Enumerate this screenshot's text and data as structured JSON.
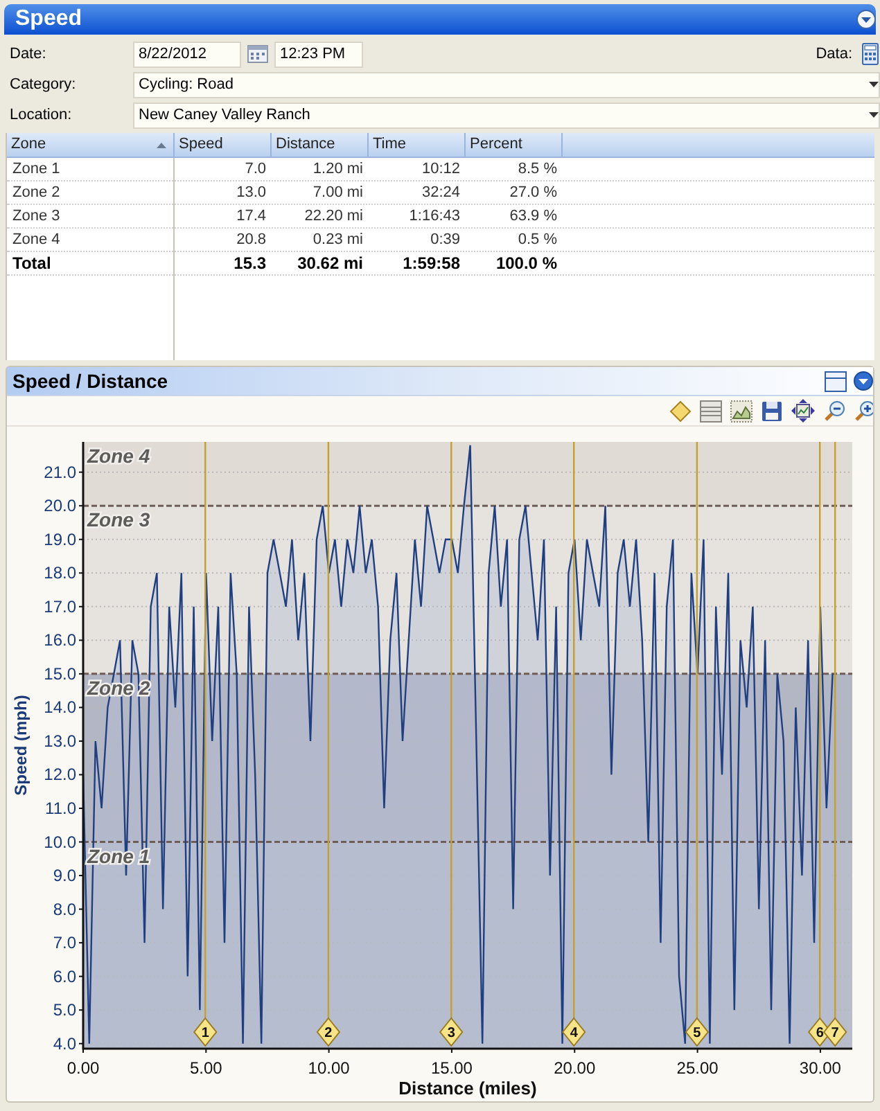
{
  "window": {
    "title": "Speed"
  },
  "form": {
    "date_label": "Date:",
    "date": "8/22/2012",
    "time": "12:23 PM",
    "data_label": "Data:",
    "category_label": "Category:",
    "category": "Cycling: Road",
    "location_label": "Location:",
    "location": "New Caney  Valley Ranch"
  },
  "table": {
    "columns": [
      {
        "label": "Zone",
        "sorted": true
      },
      {
        "label": "Speed",
        "sorted": false
      },
      {
        "label": "Distance",
        "sorted": false
      },
      {
        "label": "Time",
        "sorted": false
      },
      {
        "label": "Percent",
        "sorted": false
      }
    ],
    "rows": [
      {
        "kind": "zone",
        "cells": [
          "Zone 1",
          "7.0",
          "1.20 mi",
          "10:12",
          "8.5 %"
        ]
      },
      {
        "kind": "zone",
        "cells": [
          "Zone 2",
          "13.0",
          "7.00 mi",
          "32:24",
          "27.0 %"
        ]
      },
      {
        "kind": "zone",
        "cells": [
          "Zone 3",
          "17.4",
          "22.20 mi",
          "1:16:43",
          "63.9 %"
        ]
      },
      {
        "kind": "zone",
        "cells": [
          "Zone 4",
          "20.8",
          "0.23 mi",
          "0:39",
          "0.5 %"
        ]
      },
      {
        "kind": "total",
        "cells": [
          "Total",
          "15.3",
          "30.62 mi",
          "1:59:58",
          "100.0 %"
        ]
      }
    ]
  },
  "chart_panel": {
    "title": "Speed / Distance",
    "chart_data": {
      "type": "area",
      "grid": true,
      "xlabel": "Distance (miles)",
      "ylabel": "Speed (mph)",
      "xlim": [
        0,
        31.3
      ],
      "ylim": [
        3.85,
        21.9
      ],
      "xticks": [
        {
          "value": 0,
          "label": "0.00"
        },
        {
          "value": 5,
          "label": "5.00"
        },
        {
          "value": 10,
          "label": "10.00"
        },
        {
          "value": 15,
          "label": "15.00"
        },
        {
          "value": 20,
          "label": "20.00"
        },
        {
          "value": 25,
          "label": "25.00"
        },
        {
          "value": 30,
          "label": "30.00"
        }
      ],
      "yticks": [
        {
          "value": 4,
          "label": "4.0"
        },
        {
          "value": 5,
          "label": "5.0"
        },
        {
          "value": 6,
          "label": "6.0"
        },
        {
          "value": 7,
          "label": "7.0"
        },
        {
          "value": 8,
          "label": "8.0"
        },
        {
          "value": 9,
          "label": "9.0"
        },
        {
          "value": 10,
          "label": "10.0"
        },
        {
          "value": 11,
          "label": "11.0"
        },
        {
          "value": 12,
          "label": "12.0"
        },
        {
          "value": 13,
          "label": "13.0"
        },
        {
          "value": 14,
          "label": "14.0"
        },
        {
          "value": 15,
          "label": "15.0"
        },
        {
          "value": 16,
          "label": "16.0"
        },
        {
          "value": 17,
          "label": "17.0"
        },
        {
          "value": 18,
          "label": "18.0"
        },
        {
          "value": 19,
          "label": "19.0"
        },
        {
          "value": 20,
          "label": "20.0"
        },
        {
          "value": 21,
          "label": "21.0"
        }
      ],
      "x": [
        0,
        0.25,
        0.5,
        0.75,
        1,
        1.25,
        1.5,
        1.75,
        2,
        2.25,
        2.5,
        2.75,
        3,
        3.25,
        3.5,
        3.75,
        4,
        4.25,
        4.5,
        4.75,
        5,
        5.25,
        5.5,
        5.75,
        6,
        6.25,
        6.5,
        6.75,
        7,
        7.25,
        7.5,
        7.75,
        8,
        8.25,
        8.5,
        8.75,
        9,
        9.25,
        9.5,
        9.75,
        10,
        10.25,
        10.5,
        10.75,
        11,
        11.25,
        11.5,
        11.75,
        12,
        12.25,
        12.5,
        12.75,
        13,
        13.25,
        13.5,
        13.75,
        14,
        14.25,
        14.5,
        14.75,
        15,
        15.25,
        15.5,
        15.75,
        16,
        16.25,
        16.5,
        16.75,
        17,
        17.25,
        17.5,
        17.75,
        18,
        18.25,
        18.5,
        18.75,
        19,
        19.25,
        19.5,
        19.75,
        20,
        20.25,
        20.5,
        20.75,
        21,
        21.25,
        21.5,
        21.75,
        22,
        22.25,
        22.5,
        22.75,
        23,
        23.25,
        23.5,
        23.75,
        24,
        24.25,
        24.5,
        24.75,
        25,
        25.25,
        25.5,
        25.75,
        26,
        26.25,
        26.5,
        26.75,
        27,
        27.25,
        27.5,
        27.75,
        28,
        28.25,
        28.5,
        28.75,
        29,
        29.25,
        29.5,
        29.75,
        30,
        30.25,
        30.5
      ],
      "series": [
        {
          "color": "#1f3f80",
          "values": [
            12,
            4,
            13,
            11,
            14,
            15,
            16,
            9,
            16,
            15,
            7,
            17,
            18,
            8,
            17,
            14,
            18,
            6,
            17,
            5,
            18,
            13,
            17,
            7,
            18,
            15,
            4,
            17,
            12,
            4,
            18,
            19,
            18,
            17,
            19,
            16,
            18,
            13,
            19,
            20,
            18,
            19,
            17,
            19,
            18,
            20,
            18,
            19,
            17,
            11,
            16,
            18,
            13,
            16,
            19,
            17,
            20,
            19,
            18,
            19,
            19,
            18,
            20,
            21.8,
            13,
            4,
            18,
            20,
            17,
            19,
            8,
            19,
            20,
            18,
            16,
            19,
            9,
            17,
            4,
            18,
            19,
            16,
            19,
            18,
            17,
            20,
            12,
            18,
            19,
            17,
            19,
            16,
            10,
            18,
            7,
            17,
            19,
            6,
            4,
            18,
            15,
            19,
            4,
            17,
            12,
            18,
            5,
            16,
            14,
            17,
            8,
            16,
            5,
            15,
            13,
            4,
            14,
            9,
            16,
            7,
            17,
            11,
            15
          ]
        }
      ],
      "bands": [
        {
          "axis": "y",
          "from": 20,
          "to": 21.9,
          "label": "Zone 4",
          "color": "#e0dbd5"
        },
        {
          "axis": "y",
          "from": 15,
          "to": 20,
          "label": "Zone 3",
          "color": "#e6e3df"
        },
        {
          "axis": "y",
          "from": 10,
          "to": 15,
          "label": "Zone 2",
          "color": "#b3b6c3"
        },
        {
          "axis": "y",
          "from": 3.85,
          "to": 10,
          "label": "Zone 1",
          "color": "#b9bdca"
        }
      ],
      "annotations": [
        {
          "x": 4.97,
          "y": 3.85,
          "text": "1"
        },
        {
          "x": 9.98,
          "y": 3.85,
          "text": "2"
        },
        {
          "x": 14.98,
          "y": 3.85,
          "text": "3"
        },
        {
          "x": 19.97,
          "y": 3.85,
          "text": "4"
        },
        {
          "x": 24.98,
          "y": 3.85,
          "text": "5"
        },
        {
          "x": 29.98,
          "y": 3.85,
          "text": "6"
        },
        {
          "x": 30.6,
          "y": 3.85,
          "text": "7"
        }
      ]
    }
  }
}
